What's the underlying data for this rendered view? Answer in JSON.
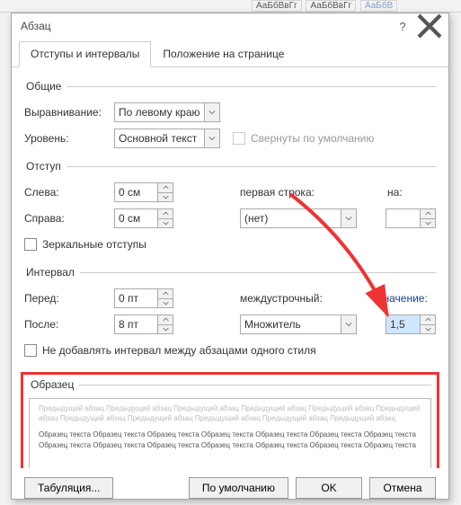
{
  "ribbon": {
    "style1": "АаБбВвГг",
    "style2": "АаБбВвГг",
    "style3": "АаБбВ"
  },
  "dialog": {
    "title": "Абзац"
  },
  "tabs": {
    "t1": "Отступы и интервалы",
    "t2": "Положение на странице"
  },
  "general": {
    "legend": "Общие",
    "align_label": "Выравнивание:",
    "align_value": "По левому краю",
    "level_label": "Уровень:",
    "level_value": "Основной текст",
    "collapse": "Свернуты по умолчанию"
  },
  "indent": {
    "legend": "Отступ",
    "left_label": "Слева:",
    "left_value": "0 см",
    "right_label": "Справа:",
    "right_value": "0 см",
    "first_label": "первая строка:",
    "first_value": "(нет)",
    "by_label": "на:",
    "by_value": "",
    "mirror": "Зеркальные отступы"
  },
  "spacing": {
    "legend": "Интервал",
    "before_label": "Перед:",
    "before_value": "0 пт",
    "after_label": "После:",
    "after_value": "8 пт",
    "line_label": "междустрочный:",
    "line_value": "Множитель",
    "at_label": "значение:",
    "at_value": "1,5",
    "nospace": "Не добавлять интервал между абзацами одного стиля"
  },
  "preview": {
    "legend": "Образец",
    "prev_text": "Предыдущий абзац Предыдущий абзац Предыдущий абзац Предыдущий абзац Предыдущий абзац Предыдущий абзац Предыдущий абзац Предыдущий абзац Предыдущий абзац Предыдущий абзац Предыдущий абзац",
    "body_text": "Образец текста Образец текста Образец текста Образец текста Образец текста Образец текста Образец текста Образец текста Образец текста Образец текста Образец текста Образец текста Образец текста Образец текста"
  },
  "buttons": {
    "tabs": "Табуляция...",
    "default": "По умолчанию",
    "ok": "OK",
    "cancel": "Отмена"
  }
}
